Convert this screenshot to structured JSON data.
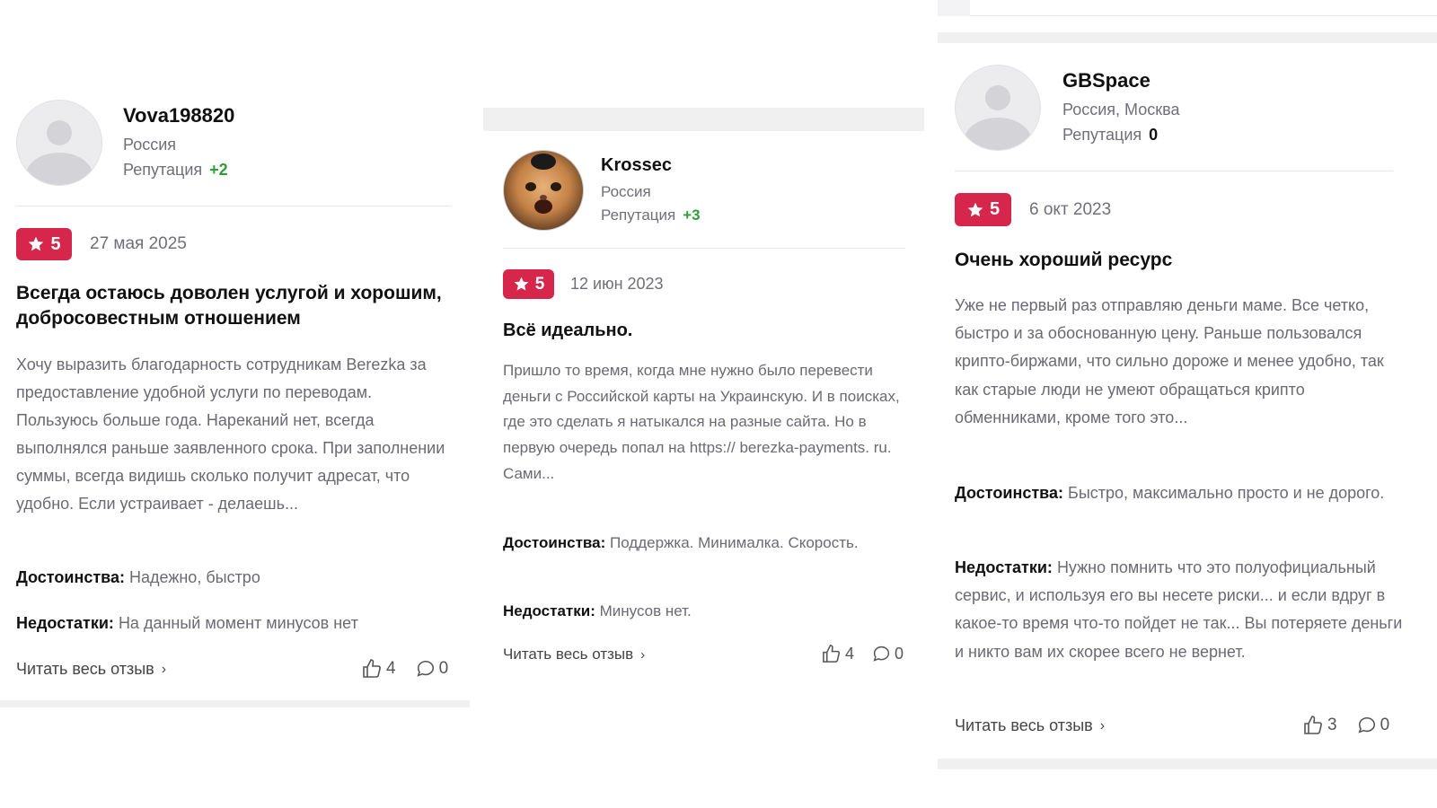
{
  "colors": {
    "badge": "#d6264b",
    "rep_positive": "#2e9e3a",
    "rep_neutral": "#111111"
  },
  "reviews": [
    {
      "username": "Vova198820",
      "location": "Россия",
      "reputation_label": "Репутация",
      "reputation": "+2",
      "rating": "5",
      "date": "27 мая 2025",
      "title": "Всегда остаюсь доволен услугой и хорошим, добросовестным отношением",
      "text": "Хочу выразить благодарность сотрудникам Berezka за предоставление удобной услуги по переводам. Пользуюсь больше года. Нареканий нет, всегда выполнялся раньше заявленного срока. При заполнении суммы, всегда видишь сколько получит адресат, что удобно. Если устраивает - делаешь...",
      "pros_label": "Достоинства:",
      "pros": "Надежно, быстро",
      "cons_label": "Недостатки:",
      "cons": "На данный момент минусов нет",
      "read_more": "Читать весь отзыв",
      "likes": "4",
      "comments": "0"
    },
    {
      "username": "Krossec",
      "location": "Россия",
      "reputation_label": "Репутация",
      "reputation": "+3",
      "rating": "5",
      "date": "12 июн 2023",
      "title": "Всё идеально.",
      "text": "Пришло то время, когда мне нужно было перевести деньги с Российской карты на Украинскую. И в поисках, где это сделать я натыкался на разные сайта. Но в первую очередь попал на https:// berezka-payments. ru. Сами...",
      "pros_label": "Достоинства:",
      "pros": "Поддержка. Минималка. Скорость.",
      "cons_label": "Недостатки:",
      "cons": "Минусов нет.",
      "read_more": "Читать весь отзыв",
      "likes": "4",
      "comments": "0"
    },
    {
      "username": "GBSpace",
      "location": "Россия, Москва",
      "reputation_label": "Репутация",
      "reputation": "0",
      "rating": "5",
      "date": "6 окт 2023",
      "title": "Очень хороший ресурс",
      "text": "Уже не первый раз отправляю деньги маме. Все четко, быстро и за обоснованную цену. Раньше пользовался крипто-биржами, что сильно дороже и менее удобно, так как старые люди не умеют обращаться крипто обменниками, кроме того это...",
      "pros_label": "Достоинства:",
      "pros": "Быстро, максимально просто и не дорого.",
      "cons_label": "Недостатки:",
      "cons": "Нужно помнить что это полуофициальный сервис, и используя его вы несете риски... и если вдруг в какое-то время что-то пойдет не так... Вы потеряете деньги и никто вам их скорее всего не вернет.",
      "read_more": "Читать весь отзыв",
      "likes": "3",
      "comments": "0"
    }
  ]
}
